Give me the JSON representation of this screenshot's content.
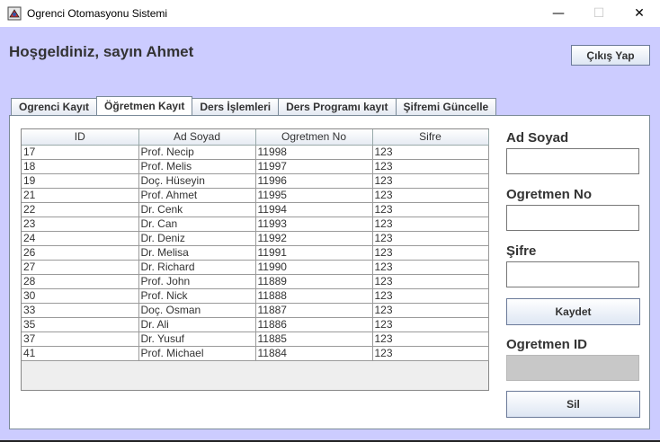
{
  "window": {
    "title": "Ogrenci Otomasyonu Sistemi",
    "minimize_glyph": "—",
    "maximize_glyph": "☐",
    "close_glyph": "✕"
  },
  "header": {
    "welcome": "Hoşgeldiniz, sayın Ahmet",
    "exit_label": "Çıkış Yap"
  },
  "tabs": [
    {
      "label": "Ogrenci Kayıt",
      "active": false
    },
    {
      "label": "Öğretmen Kayıt",
      "active": true
    },
    {
      "label": "Ders İşlemleri",
      "active": false
    },
    {
      "label": "Ders Programı kayıt",
      "active": false
    },
    {
      "label": "Şifremi Güncelle",
      "active": false
    }
  ],
  "table": {
    "columns": [
      "ID",
      "Ad Soyad",
      "Ogretmen No",
      "Sifre"
    ],
    "rows": [
      [
        "17",
        "Prof. Necip",
        "11998",
        "123"
      ],
      [
        "18",
        "Prof. Melis",
        "11997",
        "123"
      ],
      [
        "19",
        "Doç. Hüseyin",
        "11996",
        "123"
      ],
      [
        "21",
        "Prof. Ahmet",
        "11995",
        "123"
      ],
      [
        "22",
        "Dr. Cenk",
        "11994",
        "123"
      ],
      [
        "23",
        "Dr. Can",
        "11993",
        "123"
      ],
      [
        "24",
        "Dr. Deniz",
        "11992",
        "123"
      ],
      [
        "26",
        "Dr. Melisa",
        "11991",
        "123"
      ],
      [
        "27",
        "Dr. Richard",
        "11990",
        "123"
      ],
      [
        "28",
        "Prof. John",
        "11889",
        "123"
      ],
      [
        "30",
        "Prof. Nick",
        "11888",
        "123"
      ],
      [
        "33",
        "Doç. Osman",
        "11887",
        "123"
      ],
      [
        "35",
        "Dr. Ali",
        "11886",
        "123"
      ],
      [
        "37",
        "Dr. Yusuf",
        "11885",
        "123"
      ],
      [
        "41",
        "Prof. Michael",
        "11884",
        "123"
      ]
    ]
  },
  "form": {
    "ad_soyad_label": "Ad Soyad",
    "ad_soyad_value": "",
    "ogretmen_no_label": "Ogretmen No",
    "ogretmen_no_value": "",
    "sifre_label": "Şifre",
    "sifre_value": "",
    "save_label": "Kaydet",
    "ogretmen_id_label": "Ogretmen ID",
    "ogretmen_id_value": "",
    "delete_label": "Sil"
  },
  "colors": {
    "background": "#ccccff",
    "panel": "#ffffff",
    "disabled_field": "#c8c8c8"
  }
}
